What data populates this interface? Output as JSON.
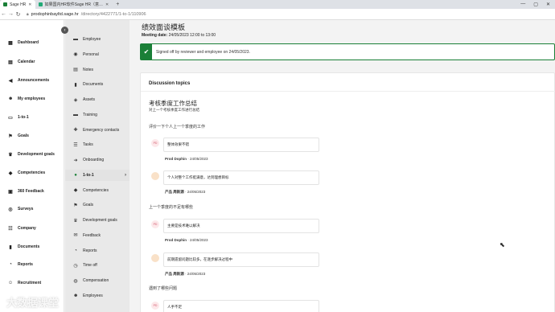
{
  "browser": {
    "tabs": [
      {
        "label": "Sage HR",
        "active": true
      },
      {
        "label": "如果国内HR软件Sage HR（意…",
        "active": false
      }
    ],
    "new_tab": "+",
    "url_domain": "prodophinbayltd.sage.hr",
    "url_path": "/directory/4422771/1-to-1/110906",
    "window_controls": [
      "—",
      "▢",
      "✕"
    ]
  },
  "sidebar": {
    "items": [
      {
        "label": "Dashboard",
        "icon": "dashboard-icon",
        "glyph": "▦"
      },
      {
        "label": "Calendar",
        "icon": "calendar-icon",
        "glyph": "▤"
      },
      {
        "label": "Announcements",
        "icon": "megaphone-icon",
        "glyph": "◀"
      },
      {
        "label": "My employees",
        "icon": "people-icon",
        "glyph": "☻"
      },
      {
        "label": "1-to-1",
        "icon": "chat-icon",
        "glyph": "▭"
      },
      {
        "label": "Goals",
        "icon": "flag-icon",
        "glyph": "⚑"
      },
      {
        "label": "Development goals",
        "icon": "trophy-icon",
        "glyph": "♛"
      },
      {
        "label": "Competencies",
        "icon": "competencies-icon",
        "glyph": "◆"
      },
      {
        "label": "360 Feedback",
        "icon": "feedback-icon",
        "glyph": "▣"
      },
      {
        "label": "Surveys",
        "icon": "survey-icon",
        "glyph": "◎"
      },
      {
        "label": "Company",
        "icon": "company-icon",
        "glyph": "☷"
      },
      {
        "label": "Documents",
        "icon": "documents-icon",
        "glyph": "▮"
      },
      {
        "label": "Reports",
        "icon": "reports-icon",
        "glyph": "◔"
      },
      {
        "label": "Recruitment",
        "icon": "recruitment-icon",
        "glyph": "☺"
      }
    ]
  },
  "subnav": {
    "items": [
      {
        "label": "Employee",
        "glyph": "▬"
      },
      {
        "label": "Personal",
        "glyph": "◉"
      },
      {
        "label": "Notes",
        "glyph": "▤"
      },
      {
        "label": "Documents",
        "glyph": "▮"
      },
      {
        "label": "Assets",
        "glyph": "◈"
      },
      {
        "label": "Training",
        "glyph": "▬"
      },
      {
        "label": "Emergency contacts",
        "glyph": "✚"
      },
      {
        "label": "Tasks",
        "glyph": "☰"
      },
      {
        "label": "Onboarding",
        "glyph": "➜"
      },
      {
        "label": "1-to-1",
        "glyph": "●",
        "active": true
      },
      {
        "label": "Competencies",
        "glyph": "◆"
      },
      {
        "label": "Goals",
        "glyph": "⚑"
      },
      {
        "label": "Development goals",
        "glyph": "♛"
      },
      {
        "label": "Feedback",
        "glyph": "✉"
      },
      {
        "label": "Reports",
        "glyph": "◔"
      },
      {
        "label": "Time off",
        "glyph": "◷"
      },
      {
        "label": "Compensation",
        "glyph": "◍"
      },
      {
        "label": "Employees",
        "glyph": "☻"
      }
    ]
  },
  "main": {
    "title": "绩效面谈模板",
    "meeting_date_label": "Meeting date:",
    "meeting_date_value": "24/05/2023 12:00 to 13:00",
    "banner_text": "Signed off by reviewer and employee on 24/05/2023.",
    "discussion_title": "Discussion topics",
    "topic_title": "考核季度工作总结",
    "topic_subtitle": "对上一个考核季度工作进行总结",
    "questions": [
      {
        "text": "评价一下个人上一个季度的工作",
        "answers": [
          {
            "avatar": "PD",
            "text": "整体效果不错",
            "author": "Prod Dophin",
            "date": "· 24/05/2023"
          },
          {
            "avatar": "",
            "text": "个人对整个工作挺满意，达到理想目标",
            "author": "产品 周新源",
            "date": "· 24/05/2023"
          }
        ]
      },
      {
        "text": "上一个季度的不足有哪些",
        "answers": [
          {
            "avatar": "PD",
            "text": "主要是技术难以解决",
            "author": "Prod Dophin",
            "date": "· 24/05/2023"
          },
          {
            "avatar": "",
            "text": "前期遗留问题比较多，在逐步解决过程中",
            "author": "产品 周新源",
            "date": "· 24/05/2023"
          }
        ]
      },
      {
        "text": "遇到了哪些问题",
        "answers": [
          {
            "avatar": "PD",
            "text": "人手不足",
            "author": "",
            "date": ""
          }
        ]
      }
    ]
  },
  "watermark": "大数据课堂"
}
